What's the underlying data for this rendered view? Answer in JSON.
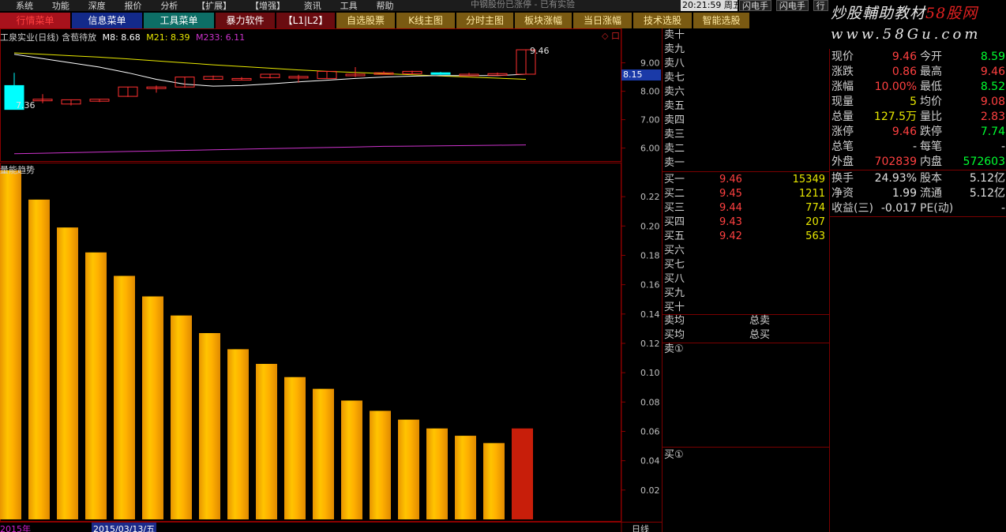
{
  "menubar": {
    "items": [
      "系统",
      "功能",
      "深度",
      "报价",
      "分析",
      "【扩展】",
      "【增强】",
      "资讯",
      "工具",
      "帮助"
    ],
    "center_title": "中钢股份已涨停 - 已有实验"
  },
  "clock": "20:21:59 周五",
  "top_right_buttons": [
    "闪电手",
    "闪电手",
    "行"
  ],
  "toolbar": [
    {
      "label": "行情菜单",
      "style": "red"
    },
    {
      "label": "信息菜单",
      "style": "blue"
    },
    {
      "label": "工具菜单",
      "style": "teal"
    },
    {
      "label": "暴力软件",
      "style": "darkred"
    },
    {
      "label": "【L1|L2】",
      "style": "darkred"
    },
    {
      "label": "自选股票",
      "style": "olive"
    },
    {
      "label": "K线主图",
      "style": "olive"
    },
    {
      "label": "分时主图",
      "style": "olive"
    },
    {
      "label": "板块涨幅",
      "style": "olive"
    },
    {
      "label": "当日涨幅",
      "style": "olive"
    },
    {
      "label": "技术选股",
      "style": "olive"
    },
    {
      "label": "智能选股",
      "style": "olive"
    }
  ],
  "watermark": {
    "line1_a": "炒股輔助教材",
    "line1_b": "58股网",
    "line2": "www.58Gu.com"
  },
  "main_panel": {
    "title": "工泉实业(日线) 含苞待放",
    "m8_label": "M8: 8.68",
    "m21_label": "M21: 8.39",
    "m233_label": "M233: 6.11",
    "price_high_label": "9.46",
    "price_low_label": "7.36",
    "current_price_tag": "8.15",
    "icons_text": "◇ 口"
  },
  "sub_panel": {
    "title": "量能趋势"
  },
  "bottom_bar": {
    "left_date": "2015年",
    "date": "2015/03/13/五",
    "right": "日线"
  },
  "colors": {
    "up": "#ff3030",
    "down": "#00ffff",
    "ma8": "#ffffff",
    "ma21": "#e8e800",
    "ma233": "#cc33cc",
    "bar_gold": "#f5a800",
    "bar_red": "#c81e0a"
  },
  "chart_data": [
    {
      "type": "candlestick",
      "title": "工泉实业(日线)",
      "ylim": [
        5.6,
        10.1
      ],
      "y_ticks": [
        6.0,
        7.0,
        8.0,
        9.0
      ],
      "y_tick_labels": [
        "6.00",
        "7.00",
        "8.00",
        "9.00"
      ],
      "candles": [
        {
          "o": 8.2,
          "h": 8.65,
          "c": 7.36,
          "l": 7.36
        },
        {
          "o": 7.7,
          "h": 7.9,
          "c": 7.72,
          "l": 7.58
        },
        {
          "o": 7.55,
          "h": 7.7,
          "c": 7.7,
          "l": 7.5
        },
        {
          "o": 7.65,
          "h": 7.72,
          "c": 7.72,
          "l": 7.62
        },
        {
          "o": 7.82,
          "h": 8.15,
          "c": 8.15,
          "l": 7.8
        },
        {
          "o": 8.15,
          "h": 8.2,
          "c": 8.15,
          "l": 7.95
        },
        {
          "o": 8.15,
          "h": 8.5,
          "c": 8.5,
          "l": 8.12
        },
        {
          "o": 8.42,
          "h": 8.55,
          "c": 8.52,
          "l": 8.4
        },
        {
          "o": 8.45,
          "h": 8.5,
          "c": 8.45,
          "l": 8.4
        },
        {
          "o": 8.48,
          "h": 8.6,
          "c": 8.6,
          "l": 8.45
        },
        {
          "o": 8.52,
          "h": 8.58,
          "c": 8.52,
          "l": 8.3
        },
        {
          "o": 8.45,
          "h": 8.7,
          "c": 8.7,
          "l": 8.45
        },
        {
          "o": 8.6,
          "h": 8.85,
          "c": 8.6,
          "l": 8.5
        },
        {
          "o": 8.62,
          "h": 8.7,
          "c": 8.65,
          "l": 8.6
        },
        {
          "o": 8.62,
          "h": 8.72,
          "c": 8.7,
          "l": 8.6
        },
        {
          "o": 8.65,
          "h": 8.68,
          "c": 8.62,
          "l": 8.58
        },
        {
          "o": 8.6,
          "h": 8.65,
          "c": 8.6,
          "l": 8.55
        },
        {
          "o": 8.62,
          "h": 8.66,
          "c": 8.62,
          "l": 8.58
        },
        {
          "o": 8.6,
          "h": 9.46,
          "c": 9.46,
          "l": 8.6
        }
      ],
      "ma8": [
        9.3,
        9.15,
        9.0,
        8.85,
        8.65,
        8.42,
        8.25,
        8.18,
        8.2,
        8.26,
        8.33,
        8.39,
        8.45,
        8.5,
        8.53,
        8.55,
        8.55,
        8.55,
        8.6
      ],
      "ma21": [
        9.35,
        9.3,
        9.25,
        9.2,
        9.14,
        9.07,
        9.0,
        8.93,
        8.87,
        8.81,
        8.75,
        8.7,
        8.66,
        8.62,
        8.58,
        8.54,
        8.5,
        8.46,
        8.42
      ],
      "ma233": [
        5.8,
        5.82,
        5.84,
        5.86,
        5.88,
        5.9,
        5.92,
        5.94,
        5.96,
        5.98,
        6.0,
        6.02,
        6.04,
        6.06,
        6.07,
        6.08,
        6.09,
        6.1,
        6.11
      ]
    },
    {
      "type": "bar",
      "title": "量能趋势",
      "ylim": [
        0,
        0.24
      ],
      "y_ticks": [
        0.02,
        0.04,
        0.06,
        0.08,
        0.1,
        0.12,
        0.14,
        0.16,
        0.18,
        0.2,
        0.22
      ],
      "y_tick_labels": [
        "0.02",
        "0.04",
        "0.06",
        "0.08",
        "0.10",
        "0.12",
        "0.14",
        "0.16",
        "0.18",
        "0.20",
        "0.22"
      ],
      "values": [
        0.238,
        0.218,
        0.199,
        0.182,
        0.166,
        0.152,
        0.139,
        0.127,
        0.116,
        0.106,
        0.097,
        0.089,
        0.081,
        0.074,
        0.068,
        0.062,
        0.057,
        0.052,
        0.062
      ],
      "highlight_last": true
    }
  ],
  "orderbook": {
    "sell": [
      {
        "label": "卖十",
        "price": "",
        "vol": ""
      },
      {
        "label": "卖九",
        "price": "",
        "vol": ""
      },
      {
        "label": "卖八",
        "price": "",
        "vol": ""
      },
      {
        "label": "卖七",
        "price": "",
        "vol": ""
      },
      {
        "label": "卖六",
        "price": "",
        "vol": ""
      },
      {
        "label": "卖五",
        "price": "",
        "vol": ""
      },
      {
        "label": "卖四",
        "price": "",
        "vol": ""
      },
      {
        "label": "卖三",
        "price": "",
        "vol": ""
      },
      {
        "label": "卖二",
        "price": "",
        "vol": ""
      },
      {
        "label": "卖一",
        "price": "",
        "vol": ""
      }
    ],
    "buy": [
      {
        "label": "买一",
        "price": "9.46",
        "vol": "15349"
      },
      {
        "label": "买二",
        "price": "9.45",
        "vol": "1211"
      },
      {
        "label": "买三",
        "price": "9.44",
        "vol": "774"
      },
      {
        "label": "买四",
        "price": "9.43",
        "vol": "207"
      },
      {
        "label": "买五",
        "price": "9.42",
        "vol": "563"
      },
      {
        "label": "买六",
        "price": "",
        "vol": ""
      },
      {
        "label": "买七",
        "price": "",
        "vol": ""
      },
      {
        "label": "买八",
        "price": "",
        "vol": ""
      },
      {
        "label": "买九",
        "price": "",
        "vol": ""
      },
      {
        "label": "买十",
        "price": "",
        "vol": ""
      }
    ],
    "avg": [
      {
        "label": "卖均",
        "extra": "总卖"
      },
      {
        "label": "买均",
        "extra": "总买"
      }
    ],
    "queue_sell_label": "卖①",
    "queue_buy_label": "买①"
  },
  "quote": {
    "rows": [
      {
        "l1": "现价",
        "v1": "9.46",
        "c1": "red",
        "l2": "今开",
        "v2": "8.59",
        "c2": "green"
      },
      {
        "l1": "涨跌",
        "v1": "0.86",
        "c1": "red",
        "l2": "最高",
        "v2": "9.46",
        "c2": "red"
      },
      {
        "l1": "涨幅",
        "v1": "10.00%",
        "c1": "red",
        "l2": "最低",
        "v2": "8.52",
        "c2": "green"
      },
      {
        "l1": "现量",
        "v1": "5",
        "c1": "yellow",
        "l2": "均价",
        "v2": "9.08",
        "c2": "red"
      },
      {
        "l1": "总量",
        "v1": "127.5万",
        "c1": "yellow",
        "l2": "量比",
        "v2": "2.83",
        "c2": "red"
      },
      {
        "l1": "涨停",
        "v1": "9.46",
        "c1": "red",
        "l2": "跌停",
        "v2": "7.74",
        "c2": "green"
      },
      {
        "l1": "总笔",
        "v1": "-",
        "c1": "white",
        "l2": "每笔",
        "v2": "-",
        "c2": "white"
      },
      {
        "l1": "外盘",
        "v1": "702839",
        "c1": "red",
        "l2": "内盘",
        "v2": "572603",
        "c2": "green"
      }
    ],
    "rows2": [
      {
        "l1": "换手",
        "v1": "24.93%",
        "c1": "white",
        "l2": "股本",
        "v2": "5.12亿",
        "c2": "white"
      },
      {
        "l1": "净资",
        "v1": "1.99",
        "c1": "white",
        "l2": "流通",
        "v2": "5.12亿",
        "c2": "white"
      },
      {
        "l1": "收益(三)",
        "v1": "-0.017",
        "c1": "white",
        "l2": "PE(动)",
        "v2": "-",
        "c2": "white"
      }
    ]
  }
}
